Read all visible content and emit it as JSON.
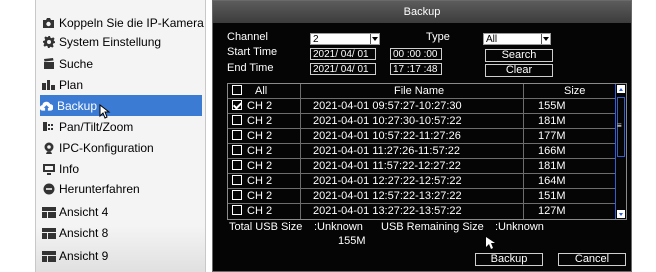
{
  "menu": {
    "items": [
      {
        "label": "Koppeln Sie die IP-Kamera",
        "icon": "camera-icon"
      },
      {
        "label": "System Einstellung",
        "icon": "gear-icon"
      },
      {
        "label": "Suche",
        "icon": "film-icon"
      },
      {
        "label": "Plan",
        "icon": "calendar-icon"
      },
      {
        "label": "Backup",
        "icon": "cloud-upload-icon"
      },
      {
        "label": "Pan/Tilt/Zoom",
        "icon": "ptz-icon"
      },
      {
        "label": "IPC-Konfiguration",
        "icon": "webcam-icon"
      },
      {
        "label": "Info",
        "icon": "monitor-icon"
      },
      {
        "label": "Herunterfahren",
        "icon": "power-icon"
      },
      {
        "label": "Ansicht 4",
        "icon": "layout-icon"
      },
      {
        "label": "Ansicht 8",
        "icon": "layout-icon"
      },
      {
        "label": "Ansicht 9",
        "icon": "layout-icon"
      }
    ],
    "active_item": "Backup"
  },
  "dialog": {
    "title": "Backup",
    "channel_label": "Channel",
    "channel_value": "2",
    "type_label": "Type",
    "type_value": "All",
    "start_time_label": "Start Time",
    "start_date": "2021/ 04/ 01",
    "start_time": "00 :00 :00",
    "end_time_label": "End Time",
    "end_date": "2021/ 04/ 01",
    "end_time": "17 :17 :48",
    "search_button": "Search",
    "clear_button": "Clear",
    "table": {
      "headers": {
        "all": "All",
        "file_name": "File Name",
        "size": "Size"
      },
      "rows": [
        {
          "channel": "CH 2",
          "file": "2021-04-01 09:57:27-10:27:30",
          "size": "155M",
          "checked": true
        },
        {
          "channel": "CH 2",
          "file": "2021-04-01 10:27:30-10:57:22",
          "size": "181M",
          "checked": false
        },
        {
          "channel": "CH 2",
          "file": "2021-04-01 10:57:22-11:27:26",
          "size": "177M",
          "checked": false
        },
        {
          "channel": "CH 2",
          "file": "2021-04-01 11:27:26-11:57:22",
          "size": "166M",
          "checked": false
        },
        {
          "channel": "CH 2",
          "file": "2021-04-01 11:57:22-12:27:22",
          "size": "181M",
          "checked": false
        },
        {
          "channel": "CH 2",
          "file": "2021-04-01 12:27:22-12:57:22",
          "size": "164M",
          "checked": false
        },
        {
          "channel": "CH 2",
          "file": "2021-04-01 12:57:22-13:27:22",
          "size": "151M",
          "checked": false
        },
        {
          "channel": "CH 2",
          "file": "2021-04-01 13:27:22-13:57:22",
          "size": "127M",
          "checked": false
        }
      ]
    },
    "total_usb_size_label": "Total USB Size",
    "total_usb_size_value": ":Unknown",
    "usb_remaining_label": "USB Remaining Size",
    "usb_remaining_value": ":Unknown",
    "selected_size": "155M",
    "backup_button": "Backup",
    "cancel_button": "Cancel"
  }
}
